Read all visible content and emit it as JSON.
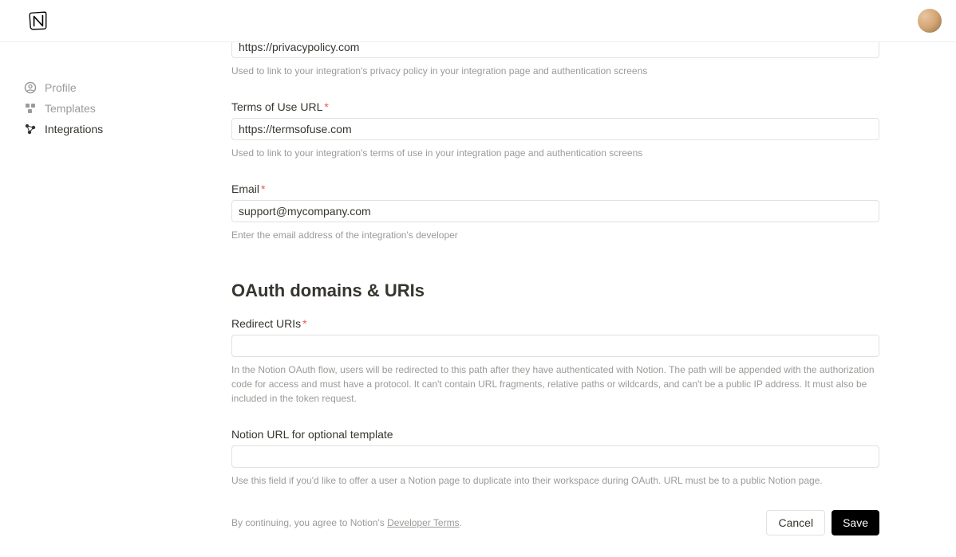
{
  "sidebar": {
    "items": [
      {
        "label": "Profile",
        "active": false
      },
      {
        "label": "Templates",
        "active": false
      },
      {
        "label": "Integrations",
        "active": true
      }
    ]
  },
  "fields": {
    "privacy": {
      "value": "https://privacypolicy.com",
      "help": "Used to link to your integration's privacy policy in your integration page and authentication screens"
    },
    "terms": {
      "label": "Terms of Use URL",
      "value": "https://termsofuse.com",
      "help": "Used to link to your integration's terms of use in your integration page and authentication screens"
    },
    "email": {
      "label": "Email",
      "value": "support@mycompany.com",
      "help": "Enter the email address of the integration's developer"
    },
    "redirect": {
      "label": "Redirect URIs",
      "value": "",
      "help": "In the Notion OAuth flow, users will be redirected to this path after they have authenticated with Notion. The path will be appended with the authorization code for access and must have a protocol. It can't contain URL fragments, relative paths or wildcards, and can't be a public IP address. It must also be included in the token request."
    },
    "template": {
      "label": "Notion URL for optional template",
      "value": "",
      "help": "Use this field if you'd like to offer a user a Notion page to duplicate into their workspace during OAuth. URL must be to a public Notion page."
    }
  },
  "section": {
    "heading": "OAuth domains & URIs"
  },
  "footer": {
    "consent_prefix": "By continuing, you agree to Notion's ",
    "consent_link": "Developer Terms",
    "consent_suffix": ".",
    "cancel": "Cancel",
    "save": "Save"
  }
}
